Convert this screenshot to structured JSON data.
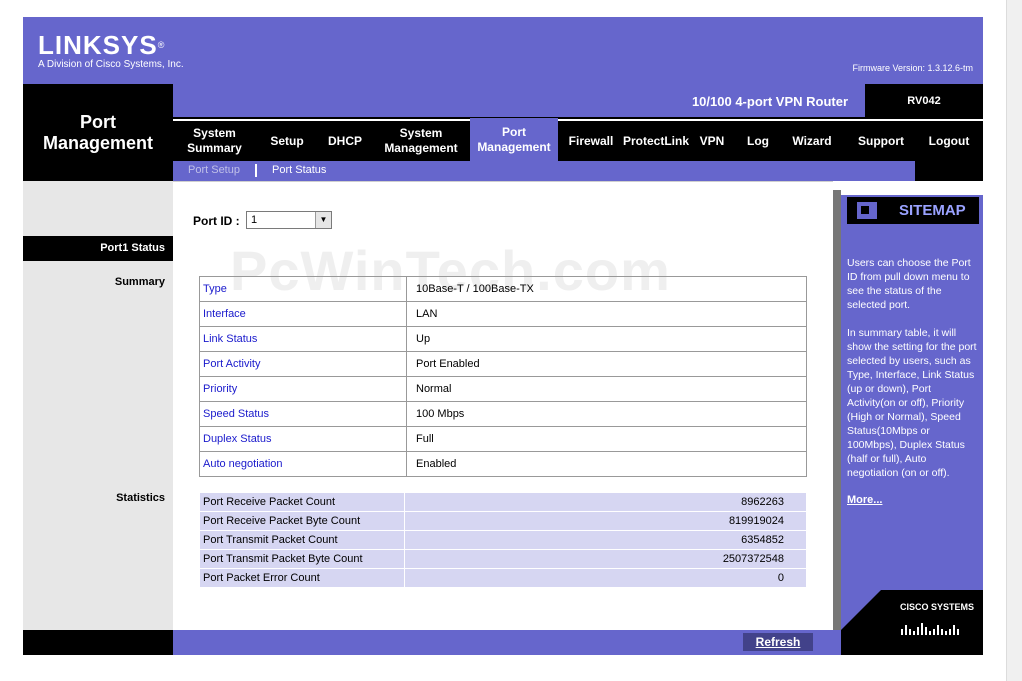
{
  "header": {
    "brand": "LINKSYS",
    "tagline": "A Division of Cisco Systems, Inc.",
    "firmware": "Firmware Version: 1.3.12.6-tm",
    "product_name": "10/100 4-port VPN Router",
    "model": "RV042"
  },
  "page_title": "Port\nManagement",
  "menu": {
    "items": [
      {
        "label": "System\nSummary"
      },
      {
        "label": "Setup"
      },
      {
        "label": "DHCP"
      },
      {
        "label": "System\nManagement"
      },
      {
        "label": "Port\nManagement",
        "active": true
      },
      {
        "label": "Firewall"
      },
      {
        "label": "ProtectLink"
      },
      {
        "label": "VPN"
      },
      {
        "label": "Log"
      },
      {
        "label": "Wizard"
      },
      {
        "label": "Support"
      },
      {
        "label": "Logout"
      }
    ],
    "submenu": [
      "Port Setup",
      "Port Status"
    ],
    "submenu_active": "Port Status"
  },
  "left": {
    "section_title": "Port1 Status",
    "summary_label": "Summary",
    "statistics_label": "Statistics"
  },
  "watermark": "PcWinTech.com",
  "port_id": {
    "label": "Port ID :",
    "selected": "1"
  },
  "summary": [
    {
      "key": "Type",
      "value": "10Base-T / 100Base-TX"
    },
    {
      "key": "Interface",
      "value": "LAN"
    },
    {
      "key": "Link Status",
      "value": "Up"
    },
    {
      "key": "Port Activity",
      "value": "Port Enabled"
    },
    {
      "key": "Priority",
      "value": "Normal"
    },
    {
      "key": "Speed Status",
      "value": "100 Mbps"
    },
    {
      "key": "Duplex Status",
      "value": "Full"
    },
    {
      "key": "Auto negotiation",
      "value": "Enabled"
    }
  ],
  "statistics": [
    {
      "key": "Port Receive Packet Count",
      "value": "8962263"
    },
    {
      "key": "Port Receive Packet Byte Count",
      "value": "819919024"
    },
    {
      "key": "Port Transmit Packet Count",
      "value": "6354852"
    },
    {
      "key": "Port Transmit Packet Byte Count",
      "value": "2507372548"
    },
    {
      "key": "Port Packet Error Count",
      "value": "0"
    }
  ],
  "sitemap": {
    "title": "SITEMAP",
    "help_text": "Users can choose the Port ID from pull down menu to see the status of the selected port.\n\nIn summary table, it will show the setting for the port selected by users, such as Type, Interface, Link Status (up or down), Port Activity(on or off), Priority (High or Normal), Speed Status(10Mbps or 100Mbps), Duplex Status (half or full), Auto negotiation (on or off).",
    "more": "More..."
  },
  "cisco_logo": "CISCO SYSTEMS",
  "footer": {
    "refresh": "Refresh"
  },
  "colors": {
    "accent": "#6666cc",
    "dark": "#000000",
    "link": "#1a1acc",
    "stats_bg": "#d6d6f2"
  }
}
